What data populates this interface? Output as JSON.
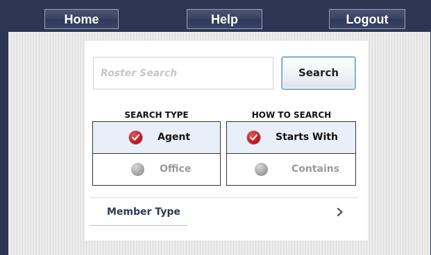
{
  "nav": {
    "home": "Home",
    "help": "Help",
    "logout": "Logout"
  },
  "search": {
    "placeholder": "Roster Search",
    "value": "",
    "button_label": "Search"
  },
  "search_type": {
    "title": "SEARCH TYPE",
    "options": [
      {
        "label": "Agent",
        "selected": true
      },
      {
        "label": "Office",
        "selected": false
      }
    ]
  },
  "how_to_search": {
    "title": "HOW TO SEARCH",
    "options": [
      {
        "label": "Starts With",
        "selected": true
      },
      {
        "label": "Contains",
        "selected": false
      }
    ]
  },
  "member_type": {
    "label": "Member Type",
    "icon": "chevron-right-icon"
  },
  "icons": {
    "selected_radio": "check-radio-icon",
    "unselected_radio": "radio-off-icon"
  },
  "colors": {
    "topbar": "#2c3553",
    "selected_row": "#e9eff8",
    "radio_on": "#c21e27",
    "muted_text": "#9a9a9a"
  }
}
